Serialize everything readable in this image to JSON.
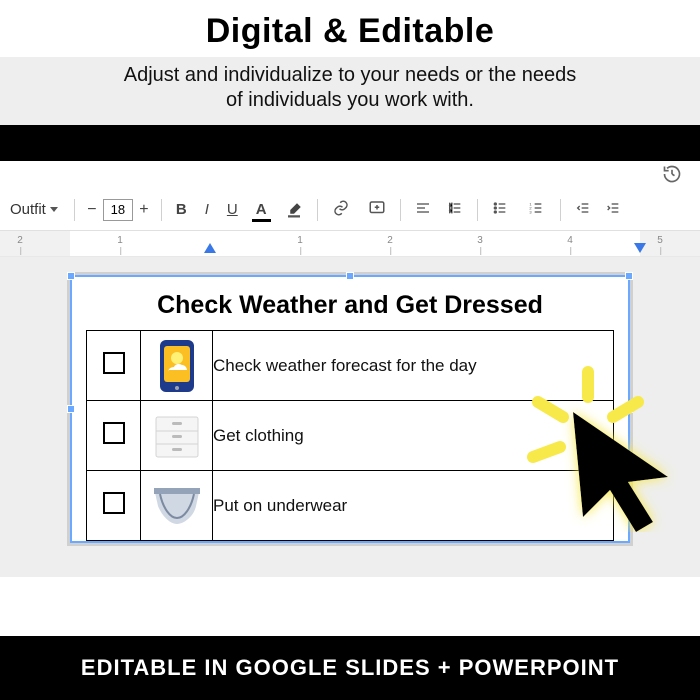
{
  "promo": {
    "title": "Digital & Editable",
    "subtitle_line1": "Adjust and individualize to your needs or the needs",
    "subtitle_line2": "of individuals you work with."
  },
  "toolbar": {
    "style_name": "Outfit",
    "font_size": "18"
  },
  "ruler": {
    "labels": [
      "2",
      "1",
      "1",
      "2",
      "3",
      "4",
      "5"
    ]
  },
  "document": {
    "title": "Check Weather and Get Dressed",
    "rows": [
      {
        "text": "Check weather forecast for the day",
        "icon": "phone"
      },
      {
        "text": "Get clothing",
        "icon": "dresser"
      },
      {
        "text": "Put on underwear",
        "icon": "underwear"
      }
    ]
  },
  "bottom_bar": "EDITABLE IN GOOGLE SLIDES + POWERPOINT"
}
